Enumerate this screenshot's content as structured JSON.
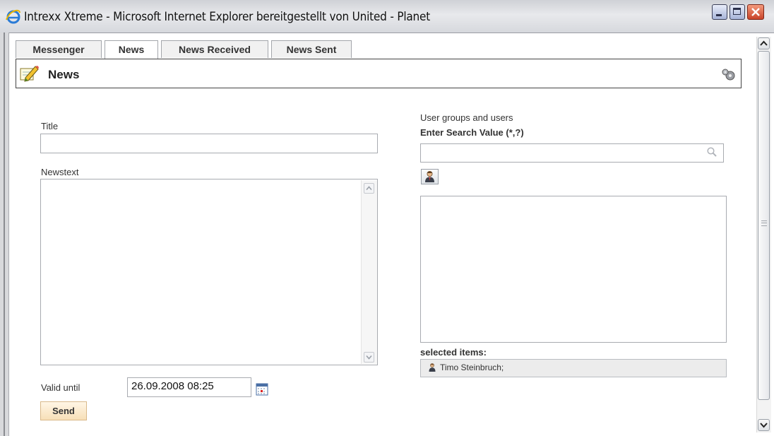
{
  "window": {
    "title": "Intrexx Xtreme - Microsoft Internet Explorer bereitgestellt von United - Planet",
    "controls": [
      "minimize-icon",
      "maximize-icon",
      "close-icon"
    ]
  },
  "tabs": [
    {
      "label": "Messenger"
    },
    {
      "label": "News",
      "active": true
    },
    {
      "label": "News Received"
    },
    {
      "label": "News Sent"
    }
  ],
  "header": {
    "title": "News",
    "icon": "pencil-note-icon",
    "settings_icon": "gear-icon"
  },
  "form": {
    "title_label": "Title",
    "title_value": "",
    "newstext_label": "Newstext",
    "newstext_value": "",
    "valid_until_label": "Valid until",
    "valid_until_value": "26.09.2008 08:25",
    "send_label": "Send"
  },
  "users_panel": {
    "heading": "User groups and users",
    "search_label": "Enter Search Value (*,?)",
    "search_value": "",
    "selected_label": "selected items:",
    "selected_value": "Timo Steinbruch;"
  },
  "colors": {
    "send_button_bg": "#f7dfb7",
    "close_button": "#c9442a",
    "frame_border": "#444444"
  }
}
